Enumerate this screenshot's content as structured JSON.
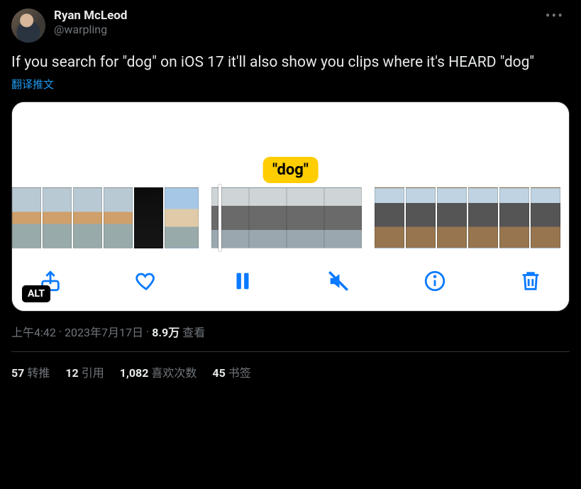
{
  "author": {
    "display_name": "Ryan McLeod",
    "handle": "@warpling"
  },
  "tweet_text": "If you search for \"dog\" on iOS 17 it'll also show you clips where it's HEARD \"dog\"",
  "translate_label": "翻译推文",
  "embedded": {
    "search_tag": "\"dog\"",
    "alt_label": "ALT",
    "icons": {
      "share": "share-icon",
      "like": "heart-icon",
      "pause": "pause-icon",
      "mute": "mute-icon",
      "info": "info-icon",
      "trash": "trash-icon"
    }
  },
  "meta": {
    "time": "上午4:42",
    "sep1": " · ",
    "date": "2023年7月17日",
    "sep2": " · ",
    "views_num": "8.9万",
    "views_label": " 查看"
  },
  "stats": {
    "retweets": {
      "num": "57",
      "label": "转推"
    },
    "quotes": {
      "num": "12",
      "label": "引用"
    },
    "likes": {
      "num": "1,082",
      "label": "喜欢次数"
    },
    "bookmarks": {
      "num": "45",
      "label": "书签"
    }
  }
}
